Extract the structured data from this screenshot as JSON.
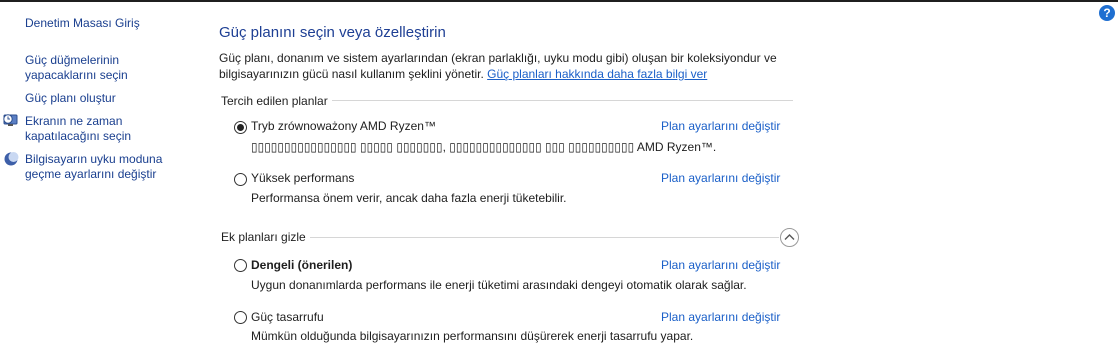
{
  "sidebar": {
    "home": "Denetim Masası Giriş",
    "items": [
      {
        "label": "Güç düğmelerinin yapacaklarını seçin",
        "icon": "none"
      },
      {
        "label": "Güç planı oluştur",
        "icon": "none"
      },
      {
        "label": "Ekranın ne zaman kapatılacağını seçin",
        "icon": "monitor-clock-icon"
      },
      {
        "label": "Bilgisayarın uyku moduna geçme ayarlarını değiştir",
        "icon": "moon-icon"
      }
    ]
  },
  "help": "?",
  "main": {
    "title": "Güç planını seçin veya özelleştirin",
    "description": "Güç planı, donanım ve sistem ayarlarından (ekran parlaklığı, uyku modu gibi) oluşan bir koleksiyondur ve bilgisayarınızın gücü nasıl kullanım şeklini yönetir.",
    "more_link": "Güç planları hakkında daha fazla bilgi ver",
    "preferred_label": "Tercih edilen planlar",
    "extra_label": "Ek planları gizle",
    "change_link": "Plan ayarlarını değiştir",
    "plans": [
      {
        "name": "Tryb zrównoważony AMD Ryzen™",
        "desc": "▯▯▯▯▯▯▯▯▯▯▯▯▯▯▯▯ ▯▯▯▯▯ ▯▯▯▯▯▯▯, ▯▯▯▯▯▯▯▯▯▯▯▯▯▯ ▯▯▯ ▯▯▯▯▯▯▯▯▯▯ AMD Ryzen™.",
        "selected": true
      },
      {
        "name": "Yüksek performans",
        "desc": "Performansa önem verir, ancak daha fazla enerji tüketebilir.",
        "selected": false
      },
      {
        "name": "Dengeli (önerilen)",
        "desc": "Uygun donanımlarda performans ile enerji tüketimi arasındaki dengeyi otomatik olarak sağlar.",
        "selected": false
      },
      {
        "name": "Güç tasarrufu",
        "desc": "Mümkün olduğunda bilgisayarınızın performansını düşürerek enerji tasarrufu yapar.",
        "selected": false
      }
    ]
  }
}
